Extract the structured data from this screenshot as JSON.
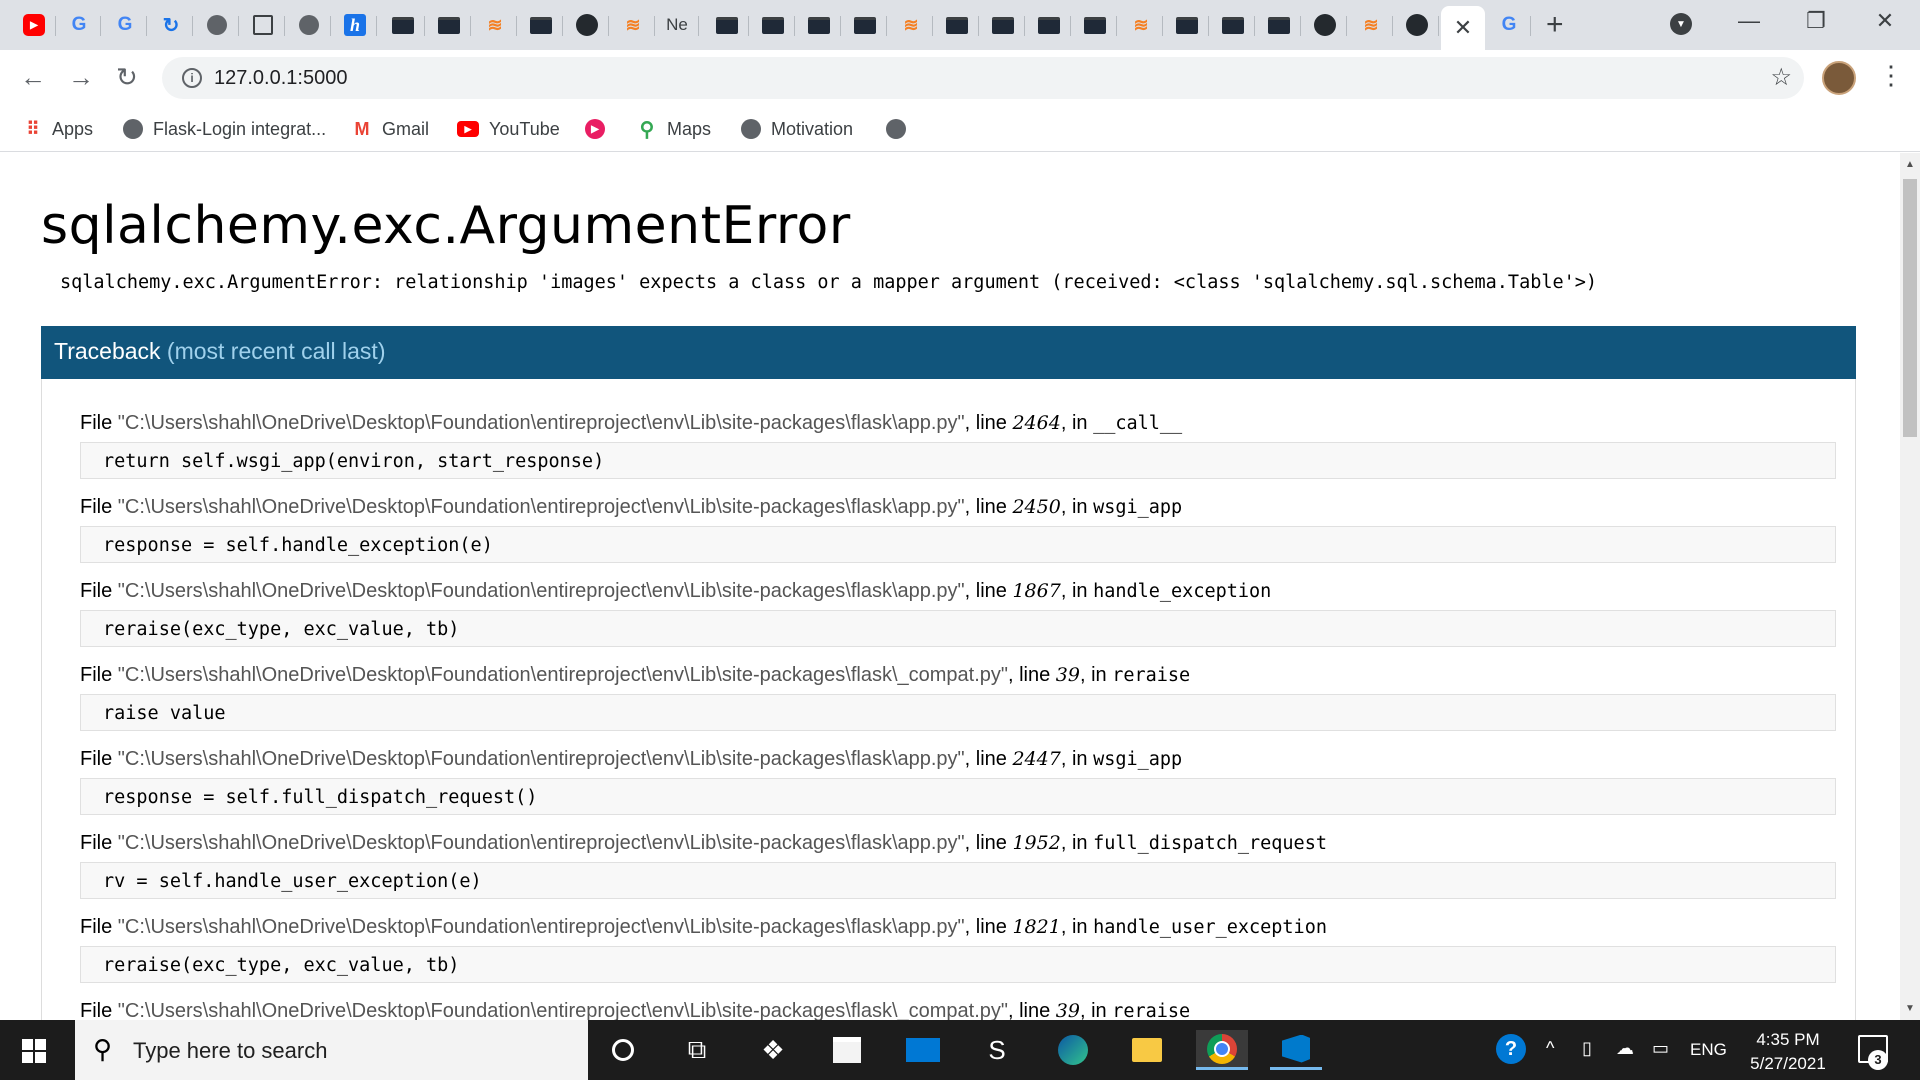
{
  "browser": {
    "tabs": [
      {
        "icon": "youtube-icon",
        "glyph": "▶"
      },
      {
        "icon": "google-icon",
        "glyph": "G"
      },
      {
        "icon": "google-icon",
        "glyph": "G"
      },
      {
        "icon": "extension-icon",
        "glyph": "↻"
      },
      {
        "icon": "globe-icon",
        "glyph": ""
      },
      {
        "icon": "document-icon",
        "glyph": ""
      },
      {
        "icon": "globe-icon",
        "glyph": ""
      },
      {
        "icon": "h-icon",
        "glyph": "h"
      },
      {
        "icon": "terminal-icon",
        "glyph": ""
      },
      {
        "icon": "terminal-icon",
        "glyph": ""
      },
      {
        "icon": "stackoverflow-icon",
        "glyph": "≋"
      },
      {
        "icon": "terminal-icon",
        "glyph": ""
      },
      {
        "icon": "github-icon",
        "glyph": ""
      },
      {
        "icon": "stackoverflow-icon",
        "glyph": "≋"
      },
      {
        "icon": "text-tab-icon",
        "glyph": "Ne"
      },
      {
        "icon": "terminal-icon",
        "glyph": ""
      },
      {
        "icon": "terminal-icon",
        "glyph": ""
      },
      {
        "icon": "terminal-icon",
        "glyph": ""
      },
      {
        "icon": "terminal-icon",
        "glyph": ""
      },
      {
        "icon": "stackoverflow-icon",
        "glyph": "≋"
      },
      {
        "icon": "terminal-icon",
        "glyph": ""
      },
      {
        "icon": "terminal-icon",
        "glyph": ""
      },
      {
        "icon": "terminal-icon",
        "glyph": ""
      },
      {
        "icon": "terminal-icon",
        "glyph": ""
      },
      {
        "icon": "stackoverflow-icon",
        "glyph": "≋"
      },
      {
        "icon": "terminal-icon",
        "glyph": ""
      },
      {
        "icon": "terminal-icon",
        "glyph": ""
      },
      {
        "icon": "terminal-icon",
        "glyph": ""
      },
      {
        "icon": "github-icon",
        "glyph": ""
      },
      {
        "icon": "stackoverflow-icon",
        "glyph": "≋"
      },
      {
        "icon": "github-icon",
        "glyph": ""
      },
      {
        "icon": "close-icon",
        "glyph": "✕",
        "active": true
      },
      {
        "icon": "google-icon",
        "glyph": "G"
      }
    ],
    "new_tab": "+",
    "window": {
      "minimize": "—",
      "restore": "❐",
      "close": "✕"
    },
    "nav": {
      "back": "←",
      "forward": "→",
      "reload": "↻"
    },
    "address": {
      "info": "i",
      "url": "127.0.0.1:5000",
      "star": "☆"
    },
    "menu": "⋮",
    "bookmarks": [
      {
        "label": "Apps",
        "icon": "apps-icon",
        "glyph": "⠿"
      },
      {
        "label": "Flask-Login integrat...",
        "icon": "globe-icon",
        "glyph": ""
      },
      {
        "label": "Gmail",
        "icon": "gmail-icon",
        "glyph": "M"
      },
      {
        "label": "YouTube",
        "icon": "youtube-icon",
        "glyph": "▶"
      },
      {
        "label": "",
        "icon": "red-circle-icon",
        "glyph": "▶"
      },
      {
        "label": "Maps",
        "icon": "maps-icon",
        "glyph": "⚲"
      },
      {
        "label": "Motivation",
        "icon": "globe-icon",
        "glyph": ""
      },
      {
        "label": "",
        "icon": "globe-icon",
        "glyph": ""
      }
    ]
  },
  "error": {
    "title": "sqlalchemy.exc.ArgumentError",
    "message": "sqlalchemy.exc.ArgumentError: relationship 'images' expects a class or a mapper argument (received: <class 'sqlalchemy.sql.schema.Table'>)",
    "traceback_label": "Traceback",
    "traceback_hint": "(most recent call last)"
  },
  "frames": [
    {
      "file": "\"C:\\Users\\shahl\\OneDrive\\Desktop\\Foundation\\entireproject\\env\\Lib\\site-packages\\flask\\app.py\"",
      "line": "2464",
      "func": "__call__",
      "source": "return self.wsgi_app(environ, start_response)"
    },
    {
      "file": "\"C:\\Users\\shahl\\OneDrive\\Desktop\\Foundation\\entireproject\\env\\Lib\\site-packages\\flask\\app.py\"",
      "line": "2450",
      "func": "wsgi_app",
      "source": "response = self.handle_exception(e)"
    },
    {
      "file": "\"C:\\Users\\shahl\\OneDrive\\Desktop\\Foundation\\entireproject\\env\\Lib\\site-packages\\flask\\app.py\"",
      "line": "1867",
      "func": "handle_exception",
      "source": "reraise(exc_type, exc_value, tb)"
    },
    {
      "file": "\"C:\\Users\\shahl\\OneDrive\\Desktop\\Foundation\\entireproject\\env\\Lib\\site-packages\\flask\\_compat.py\"",
      "line": "39",
      "func": "reraise",
      "source": "raise value"
    },
    {
      "file": "\"C:\\Users\\shahl\\OneDrive\\Desktop\\Foundation\\entireproject\\env\\Lib\\site-packages\\flask\\app.py\"",
      "line": "2447",
      "func": "wsgi_app",
      "source": "response = self.full_dispatch_request()"
    },
    {
      "file": "\"C:\\Users\\shahl\\OneDrive\\Desktop\\Foundation\\entireproject\\env\\Lib\\site-packages\\flask\\app.py\"",
      "line": "1952",
      "func": "full_dispatch_request",
      "source": "rv = self.handle_user_exception(e)"
    },
    {
      "file": "\"C:\\Users\\shahl\\OneDrive\\Desktop\\Foundation\\entireproject\\env\\Lib\\site-packages\\flask\\app.py\"",
      "line": "1821",
      "func": "handle_user_exception",
      "source": "reraise(exc_type, exc_value, tb)"
    },
    {
      "file": "\"C:\\Users\\shahl\\OneDrive\\Desktop\\Foundation\\entireproject\\env\\Lib\\site-packages\\flask\\_compat.py\"",
      "line": "39",
      "func": "reraise",
      "source": ""
    }
  ],
  "frame_labels": {
    "file": "File ",
    "line": ", line ",
    "in": ", in "
  },
  "taskbar": {
    "search_placeholder": "Type here to search",
    "search_glyph": "⚲",
    "apps": [
      {
        "icon": "cortana-icon"
      },
      {
        "icon": "task-view-icon",
        "glyph": "⧉"
      },
      {
        "icon": "dropbox-icon",
        "glyph": "❖"
      },
      {
        "icon": "store-icon"
      },
      {
        "icon": "mail-icon"
      },
      {
        "icon": "sublime-icon",
        "glyph": "S"
      },
      {
        "icon": "edge-icon"
      },
      {
        "icon": "file-explorer-icon"
      },
      {
        "icon": "chrome-icon",
        "active": true
      },
      {
        "icon": "vscode-icon",
        "open": true
      }
    ],
    "tray": {
      "help": "?",
      "chevron": "^",
      "language": "ENG",
      "time": "4:35 PM",
      "date": "5/27/2021",
      "notifications": "3"
    }
  }
}
